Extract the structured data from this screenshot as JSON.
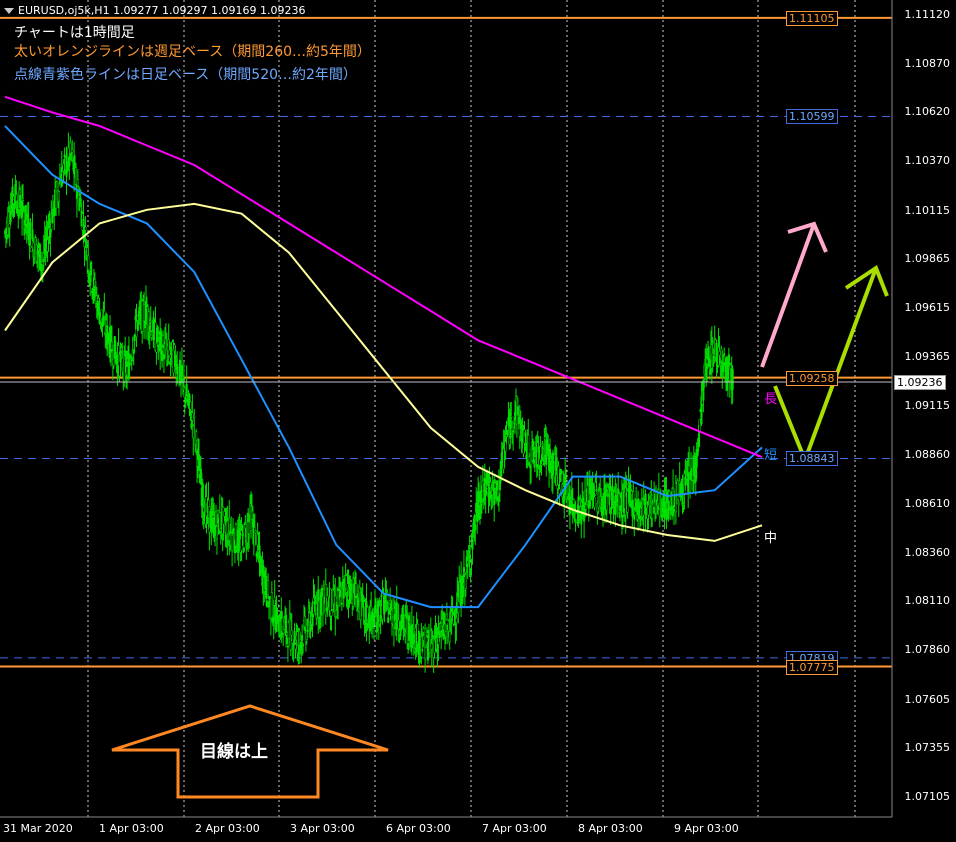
{
  "symbol_line": "EURUSD,oj5k,H1  1.09277 1.09297 1.09169 1.09236",
  "annotations": {
    "line1": "チャートは1時間足",
    "line2": "太いオレンジラインは週足ベース（期間260…約5年間）",
    "line3": "点線青紫色ラインは日足ベース（期間520…約2年間）",
    "arrow_text": "目線は上",
    "label_long": "長",
    "label_short": "短",
    "label_mid": "中"
  },
  "colors": {
    "background": "#000000",
    "candle": "#00e000",
    "orange_line": "#ff9933",
    "blue_dash": "#4169e1",
    "ma_short": "#1e90ff",
    "ma_mid": "#ffff99",
    "ma_long": "#ff00ff",
    "pink_arrow": "#ffaacc",
    "green_arrow": "#aadd00",
    "big_arrow": "#ff8822",
    "current_price": "#c0c0c0"
  },
  "chart_data": {
    "type": "line",
    "title": "EURUSD H1",
    "x_tick_labels": [
      "31 Mar 2020",
      "1 Apr 03:00",
      "2 Apr 03:00",
      "3 Apr 03:00",
      "6 Apr 03:00",
      "7 Apr 03:00",
      "8 Apr 03:00",
      "9 Apr 03:00"
    ],
    "y_tick_labels": [
      "1.11120",
      "1.10870",
      "1.10620",
      "1.10370",
      "1.10115",
      "1.09865",
      "1.09615",
      "1.09365",
      "1.09115",
      "1.08860",
      "1.08610",
      "1.08360",
      "1.08110",
      "1.07860",
      "1.07605",
      "1.07355",
      "1.07105"
    ],
    "ylim": [
      1.07,
      1.1125
    ],
    "current_price": {
      "value": 1.09236,
      "label": "1.09236"
    },
    "horizontal_levels": [
      {
        "value": 1.11105,
        "label": "1.11105",
        "style": "orange-solid"
      },
      {
        "value": 1.10599,
        "label": "1.10599",
        "style": "blue-dash"
      },
      {
        "value": 1.09258,
        "label": "1.09258",
        "style": "orange-solid"
      },
      {
        "value": 1.08843,
        "label": "1.08843",
        "style": "blue-dash"
      },
      {
        "value": 1.07819,
        "label": "1.07819",
        "style": "blue-dash"
      },
      {
        "value": 1.07775,
        "label": "1.07775",
        "style": "orange-solid"
      }
    ],
    "price_path": [
      [
        0,
        1.1
      ],
      [
        1,
        1.102
      ],
      [
        2,
        1.101
      ],
      [
        3,
        1.0995
      ],
      [
        4,
        1.0985
      ],
      [
        5,
        1.101
      ],
      [
        6,
        1.103
      ],
      [
        7,
        1.104
      ],
      [
        8,
        1.1015
      ],
      [
        9,
        1.098
      ],
      [
        10,
        1.096
      ],
      [
        11,
        1.0945
      ],
      [
        12,
        1.0935
      ],
      [
        13,
        1.093
      ],
      [
        14,
        1.0955
      ],
      [
        15,
        1.096
      ],
      [
        16,
        1.0945
      ],
      [
        17,
        1.094
      ],
      [
        18,
        1.0935
      ],
      [
        19,
        1.092
      ],
      [
        20,
        1.09
      ],
      [
        21,
        1.086
      ],
      [
        22,
        1.085
      ],
      [
        23,
        1.0852
      ],
      [
        24,
        1.0845
      ],
      [
        25,
        1.084
      ],
      [
        26,
        1.0855
      ],
      [
        27,
        1.083
      ],
      [
        28,
        1.081
      ],
      [
        29,
        1.08
      ],
      [
        30,
        1.0795
      ],
      [
        31,
        1.079
      ],
      [
        32,
        1.0798
      ],
      [
        33,
        1.081
      ],
      [
        34,
        1.0812
      ],
      [
        35,
        1.0808
      ],
      [
        36,
        1.082
      ],
      [
        37,
        1.0815
      ],
      [
        38,
        1.0805
      ],
      [
        39,
        1.08
      ],
      [
        40,
        1.081
      ],
      [
        41,
        1.0805
      ],
      [
        42,
        1.08
      ],
      [
        43,
        1.0795
      ],
      [
        44,
        1.079
      ],
      [
        45,
        1.0788
      ],
      [
        46,
        1.0795
      ],
      [
        47,
        1.0798
      ],
      [
        48,
        1.0812
      ],
      [
        49,
        1.083
      ],
      [
        50,
        1.086
      ],
      [
        51,
        1.087
      ],
      [
        52,
        1.0865
      ],
      [
        53,
        1.0895
      ],
      [
        54,
        1.091
      ],
      [
        55,
        1.089
      ],
      [
        56,
        1.0885
      ],
      [
        57,
        1.089
      ],
      [
        58,
        1.088
      ],
      [
        59,
        1.087
      ],
      [
        60,
        1.086
      ],
      [
        61,
        1.0858
      ],
      [
        62,
        1.0868
      ],
      [
        63,
        1.0862
      ],
      [
        64,
        1.0866
      ],
      [
        65,
        1.086
      ],
      [
        66,
        1.0864
      ],
      [
        67,
        1.0858
      ],
      [
        68,
        1.086
      ],
      [
        69,
        1.0862
      ],
      [
        70,
        1.086
      ],
      [
        71,
        1.0865
      ],
      [
        72,
        1.087
      ],
      [
        73,
        1.088
      ],
      [
        74,
        1.093
      ],
      [
        75,
        1.094
      ],
      [
        76,
        1.0935
      ],
      [
        77,
        1.0925
      ]
    ],
    "series": [
      {
        "key": "short",
        "values": [
          [
            0,
            1.1055
          ],
          [
            5,
            1.103
          ],
          [
            10,
            1.1015
          ],
          [
            15,
            1.1005
          ],
          [
            20,
            1.098
          ],
          [
            25,
            1.0935
          ],
          [
            30,
            1.089
          ],
          [
            35,
            1.084
          ],
          [
            40,
            1.0815
          ],
          [
            45,
            1.0808
          ],
          [
            50,
            1.0808
          ],
          [
            55,
            1.084
          ],
          [
            60,
            1.0875
          ],
          [
            65,
            1.0875
          ],
          [
            70,
            1.0865
          ],
          [
            75,
            1.0868
          ],
          [
            80,
            1.089
          ]
        ]
      },
      {
        "key": "mid",
        "values": [
          [
            0,
            1.095
          ],
          [
            5,
            1.0985
          ],
          [
            10,
            1.1005
          ],
          [
            15,
            1.1012
          ],
          [
            20,
            1.1015
          ],
          [
            25,
            1.101
          ],
          [
            30,
            1.099
          ],
          [
            35,
            1.096
          ],
          [
            40,
            1.093
          ],
          [
            45,
            1.09
          ],
          [
            50,
            1.088
          ],
          [
            55,
            1.0868
          ],
          [
            60,
            1.0858
          ],
          [
            65,
            1.085
          ],
          [
            70,
            1.0845
          ],
          [
            75,
            1.0842
          ],
          [
            80,
            1.085
          ]
        ]
      },
      {
        "key": "long",
        "values": [
          [
            0,
            1.107
          ],
          [
            5,
            1.1062
          ],
          [
            10,
            1.1055
          ],
          [
            15,
            1.1045
          ],
          [
            20,
            1.1035
          ],
          [
            25,
            1.102
          ],
          [
            30,
            1.1005
          ],
          [
            35,
            1.099
          ],
          [
            40,
            1.0975
          ],
          [
            45,
            1.096
          ],
          [
            50,
            1.0945
          ],
          [
            55,
            1.0935
          ],
          [
            60,
            1.0925
          ],
          [
            65,
            1.0915
          ],
          [
            70,
            1.0905
          ],
          [
            75,
            1.0895
          ],
          [
            80,
            1.0885
          ]
        ]
      }
    ]
  }
}
